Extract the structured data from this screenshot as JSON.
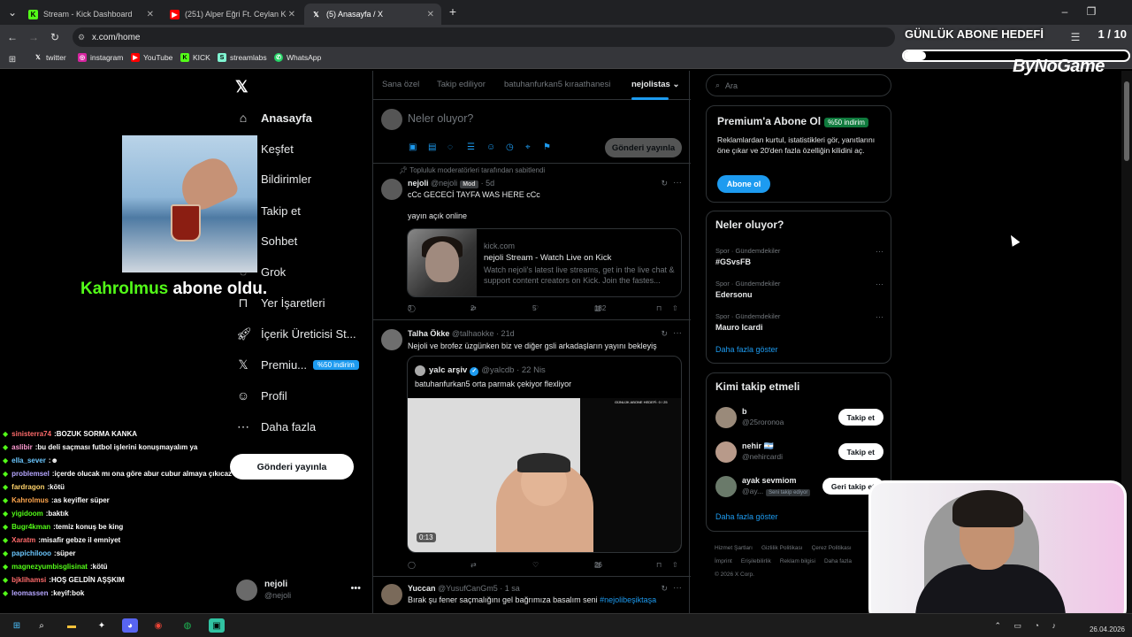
{
  "browser": {
    "tabs": [
      {
        "title": "Stream - Kick Dashboard",
        "icon": "kick-icon"
      },
      {
        "title": "(251) Alper Eğri Ft. Ceylan Koy...",
        "icon": "youtube-icon"
      },
      {
        "title": "(5) Anasayfa / X",
        "icon": "x-icon",
        "active": true
      }
    ],
    "new_tab": "+",
    "url": "x.com/home",
    "bookmarks": [
      {
        "label": "twitter",
        "icon": "x-icon"
      },
      {
        "label": "instagram",
        "icon": "instagram-icon"
      },
      {
        "label": "YouTube",
        "icon": "youtube-icon"
      },
      {
        "label": "KICK",
        "icon": "kick-icon"
      },
      {
        "label": "streamlabs",
        "icon": "streamlabs-icon"
      },
      {
        "label": "WhatsApp",
        "icon": "whatsapp-icon"
      }
    ]
  },
  "overlay": {
    "goal_title": "GÜNLÜK ABONE HEDEFİ",
    "goal_count": "1 / 10",
    "goal_progress": 0.1,
    "brand": "ByNoGame",
    "alert_user": "Kahrolmus",
    "alert_text": " abone oldu."
  },
  "chat": [
    {
      "user": "sinisterra74",
      "color": "#ff6b6b",
      "msg": "BOZUK SORMA KANKA"
    },
    {
      "user": "aslibir",
      "color": "#ff9bd2",
      "msg": "bu deli saçması futbol işlerini konuşmayalım ya"
    },
    {
      "user": "ella_sever",
      "color": "#6bc7ff",
      "msg": "☻"
    },
    {
      "user": "problemsel",
      "color": "#b6a6ff",
      "msg": "içerde olucak mı ona göre abur cubur almaya çıkıcaz acil söyle"
    },
    {
      "user": "fardragon",
      "color": "#ffd36b",
      "msg": "kötü"
    },
    {
      "user": "Kahrolmus",
      "color": "#ffa64d",
      "msg": "as keyifler süper"
    },
    {
      "user": "yigidoom",
      "color": "#53fc18",
      "msg": "baktık"
    },
    {
      "user": "Bugr4kman",
      "color": "#53fc18",
      "msg": "temiz konuş be king"
    },
    {
      "user": "Xaratm",
      "color": "#ff6b6b",
      "msg": "misafir gebze il emniyet"
    },
    {
      "user": "papichilooo",
      "color": "#6bc7ff",
      "msg": "süper"
    },
    {
      "user": "magnezyumbisglisinat",
      "color": "#53fc18",
      "msg": "kötü"
    },
    {
      "user": "bjklihamsi",
      "color": "#ff6b6b",
      "msg": "HOŞ GELDİN AŞŞKIM"
    },
    {
      "user": "leomassen",
      "color": "#b6a6ff",
      "msg": "keyif:bok"
    }
  ],
  "nav": {
    "items": [
      {
        "label": "Anasayfa",
        "icon": "home-icon"
      },
      {
        "label": "Keşfet",
        "icon": "search-icon"
      },
      {
        "label": "Bildirimler",
        "icon": "bell-icon"
      },
      {
        "label": "Takip et",
        "icon": "follow-icon"
      },
      {
        "label": "Sohbet",
        "icon": "chat-icon"
      },
      {
        "label": "Grok",
        "icon": "grok-icon"
      },
      {
        "label": "Yer İşaretleri",
        "icon": "bookmark-icon"
      },
      {
        "label": "İçerik Üreticisi St...",
        "icon": "rocket-icon"
      },
      {
        "label": "Premiu...",
        "icon": "x-icon"
      },
      {
        "label": "Profil",
        "icon": "person-icon"
      },
      {
        "label": "Daha fazla",
        "icon": "more-icon"
      }
    ],
    "premium_badge": "%50 indirim",
    "post_button": "Gönderi yayınla",
    "me_name": "nejoli",
    "me_handle": "@nejoli"
  },
  "feed": {
    "tabs": [
      "Sana özel",
      "Takip ediliyor",
      "batuhanfurkan5 kıraathanesi",
      "nejolistas"
    ],
    "compose_placeholder": "Neler oluyor?",
    "compose_post": "Gönderi yayınla",
    "pinned_label": "Topluluk moderatörleri tarafından sabitlendi",
    "tweet1": {
      "name": "nejoli",
      "handle": "@nejoli",
      "badge": "Mod",
      "time": "· 5d",
      "line1": "cCc GECECİ TAYFA WAS HERE cCc",
      "line2": "yayın açık online",
      "card_domain": "kick.com",
      "card_title": "nejoli Stream - Watch Live on Kick",
      "card_desc": "Watch nejoli's latest live streams, get in the live chat & support content creators on Kick. Join the fastes...",
      "replies": "3",
      "reposts": "2",
      "likes": "5",
      "views": "182"
    },
    "tweet2": {
      "name": "Talha Ökke",
      "handle": "@talhaokke",
      "time": "· 21d",
      "text": "Nejoli ve brofez üzgünken biz ve diğer gsli arkadaşların yayını bekleyiş",
      "quote_name": "yalc arşiv",
      "quote_handle": "@yalcdb · 22 Nis",
      "quote_text": "batuhanfurkan5 orta parmak çekiyor flexliyor",
      "video_time": "0:13",
      "video_overlay": "GÜNLÜK ABONE HEDEFİ: 0 / 25",
      "views": "26"
    },
    "tweet3": {
      "name": "Yuccan",
      "handle": "@YusufCanGm5",
      "time": "· 1 sa",
      "text": "Bırak şu fener saçmalığını gel bağrımıza basalım seni ",
      "hashtag": "#nejolibeşiktaşa"
    }
  },
  "right": {
    "search_placeholder": "Ara",
    "premium": {
      "title": "Premium'a Abone Ol",
      "discount": "%50 indirim",
      "desc": "Reklamlardan kurtul, istatistikleri gör, yanıtlarını öne çıkar ve 20'den fazla özelliğin kilidini aç.",
      "button": "Abone ol"
    },
    "trends_title": "Neler oluyor?",
    "trends": [
      {
        "category": "Spor · Gündemdekiler",
        "topic": "#GSvsFB"
      },
      {
        "category": "Spor · Gündemdekiler",
        "topic": "Edersonu"
      },
      {
        "category": "Spor · Gündemdekiler",
        "topic": "Mauro Icardi"
      }
    ],
    "trends_more": "Daha fazla göster",
    "wtf_title": "Kimi takip etmeli",
    "wtf": [
      {
        "name": "b",
        "handle": "@25roronoa",
        "button": "Takip et"
      },
      {
        "name": "nehir 🇦🇷",
        "handle": "@nehircardi",
        "button": "Takip et"
      },
      {
        "name": "ayak sevmiom",
        "handle": "@ay...",
        "follows_you": "Seni takip ediyor",
        "button": "Geri takip et"
      }
    ],
    "wtf_more": "Daha fazla göster",
    "footer": [
      "Hizmet Şartları",
      "Gizlilik Politikası",
      "Çerez Politikası",
      "İmprint",
      "Erişilebilirlik",
      "Reklam bilgisi",
      "Daha fazla",
      "© 2026 X Corp."
    ]
  },
  "taskbar": {
    "date": "26.04.2026"
  }
}
